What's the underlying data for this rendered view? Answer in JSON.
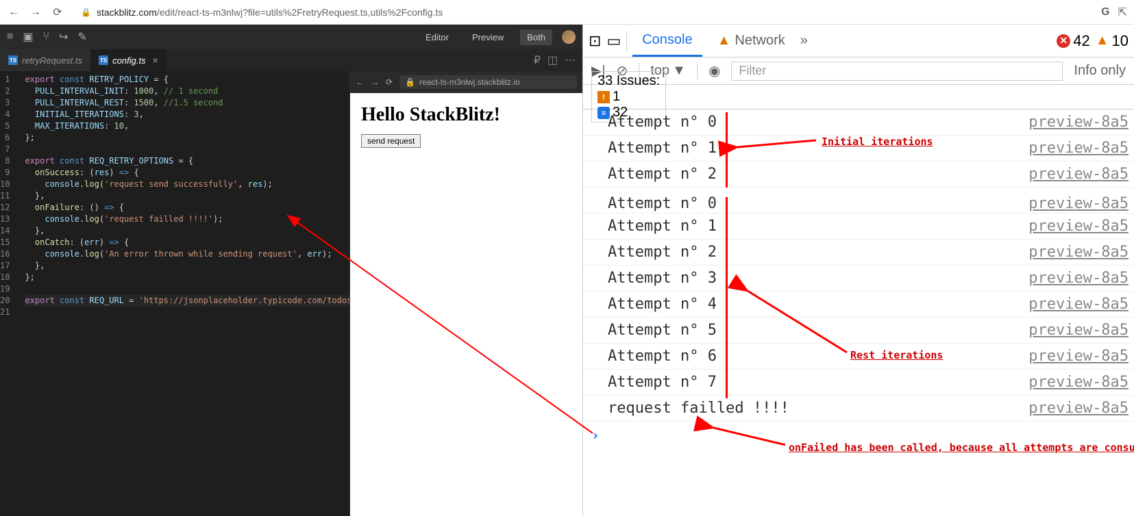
{
  "browser": {
    "url_prefix": "stackblitz.com",
    "url_path": "/edit/react-ts-m3nlwj?file=utils%2FretryRequest.ts,utils%2Fconfig.ts",
    "google_g": "G"
  },
  "sb": {
    "editor_btn": "Editor",
    "preview_btn": "Preview",
    "both_btn": "Both"
  },
  "tabs": {
    "t1": "retryRequest.ts",
    "t2": "config.ts"
  },
  "preview_bar": {
    "url": "react-ts-m3nlwj.stackblitz.io"
  },
  "preview": {
    "heading": "Hello StackBlitz!",
    "button": "send request"
  },
  "code": {
    "lines": [
      "1",
      "2",
      "3",
      "4",
      "5",
      "6",
      "7",
      "8",
      "9",
      "10",
      "11",
      "12",
      "13",
      "14",
      "15",
      "16",
      "17",
      "18",
      "19",
      "20",
      "21"
    ]
  },
  "devtools": {
    "tab_console": "Console",
    "tab_network": "Network",
    "errors": "42",
    "warns": "10",
    "top": "top",
    "filter_placeholder": "Filter",
    "info_only": "Info only",
    "issues_label": "33 Issues:",
    "issues_warn": "1",
    "issues_info": "32"
  },
  "console_rows": [
    {
      "msg": "Attempt n° 0",
      "src": "preview-8a5"
    },
    {
      "msg": "Attempt n° 1",
      "src": "preview-8a5"
    },
    {
      "msg": "Attempt n° 2",
      "src": "preview-8a5"
    },
    {
      "msg": "Attempt n° 0",
      "src": "preview-8a5"
    },
    {
      "msg": "Attempt n° 1",
      "src": "preview-8a5"
    },
    {
      "msg": "Attempt n° 2",
      "src": "preview-8a5"
    },
    {
      "msg": "Attempt n° 3",
      "src": "preview-8a5"
    },
    {
      "msg": "Attempt n° 4",
      "src": "preview-8a5"
    },
    {
      "msg": "Attempt n° 5",
      "src": "preview-8a5"
    },
    {
      "msg": "Attempt n° 6",
      "src": "preview-8a5"
    },
    {
      "msg": "Attempt n° 7",
      "src": "preview-8a5"
    },
    {
      "msg": "request failled !!!!",
      "src": "preview-8a5"
    }
  ],
  "annotations": {
    "initial": "Initial iterations",
    "rest": "Rest iterations",
    "onfailed": "onFailed has been called, because all attempts are consumed"
  }
}
